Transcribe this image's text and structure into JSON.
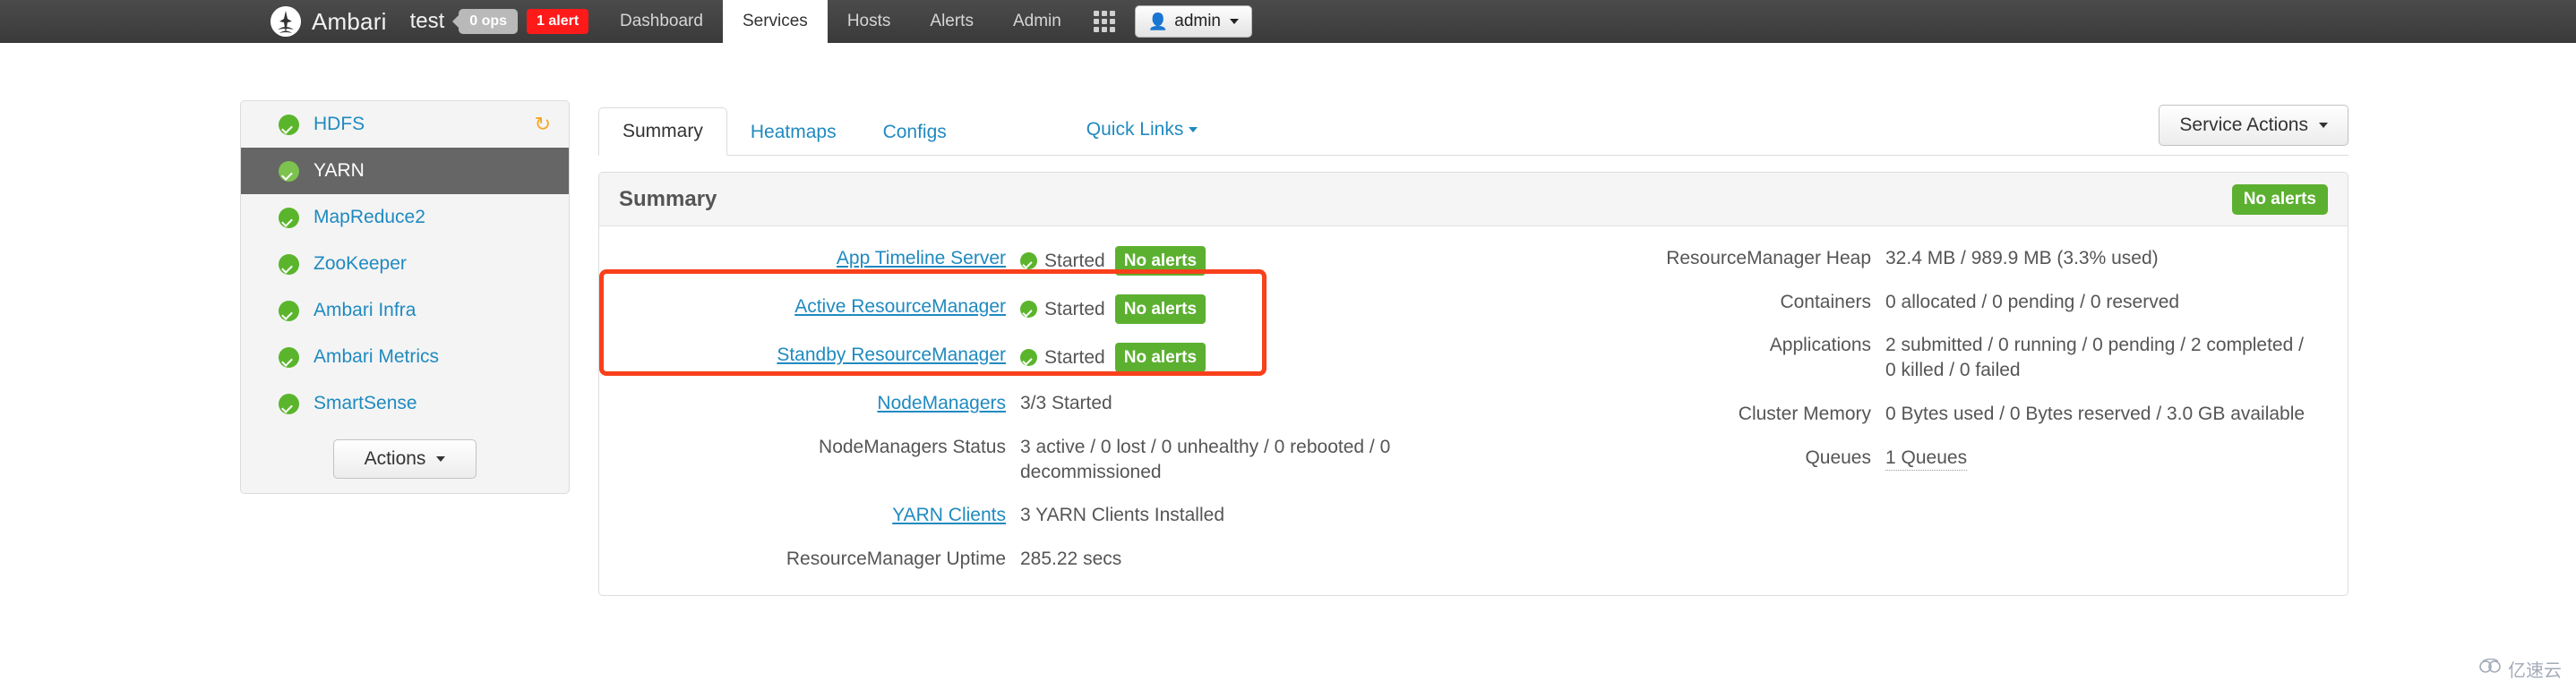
{
  "topnav": {
    "brand": "Ambari",
    "cluster": "test",
    "ops_badge": "0 ops",
    "alert_badge": "1 alert",
    "logo_icon": "ambari-logo-icon",
    "grid_icon": "app-grid-icon",
    "user_icon": "person-icon",
    "user_label": "admin",
    "items": [
      {
        "label": "Dashboard",
        "active": false
      },
      {
        "label": "Services",
        "active": true
      },
      {
        "label": "Hosts",
        "active": false
      },
      {
        "label": "Alerts",
        "active": false
      },
      {
        "label": "Admin",
        "active": false
      }
    ]
  },
  "sidebar": {
    "services": [
      {
        "label": "HDFS",
        "selected": false,
        "restart_icon": "restart-required-icon",
        "status_icon": "status-ok-icon"
      },
      {
        "label": "YARN",
        "selected": true,
        "restart_icon": "",
        "status_icon": "status-ok-icon"
      },
      {
        "label": "MapReduce2",
        "selected": false,
        "restart_icon": "",
        "status_icon": "status-ok-icon"
      },
      {
        "label": "ZooKeeper",
        "selected": false,
        "restart_icon": "",
        "status_icon": "status-ok-icon"
      },
      {
        "label": "Ambari Infra",
        "selected": false,
        "restart_icon": "",
        "status_icon": "status-ok-icon"
      },
      {
        "label": "Ambari Metrics",
        "selected": false,
        "restart_icon": "",
        "status_icon": "status-ok-icon"
      },
      {
        "label": "SmartSense",
        "selected": false,
        "restart_icon": "",
        "status_icon": "status-ok-icon"
      }
    ],
    "actions_label": "Actions"
  },
  "tabs": [
    {
      "label": "Summary",
      "active": true
    },
    {
      "label": "Heatmaps",
      "active": false
    },
    {
      "label": "Configs",
      "active": false
    }
  ],
  "quick_links_label": "Quick Links",
  "service_actions_label": "Service Actions",
  "panel": {
    "title": "Summary",
    "badge": "No alerts",
    "left_rows": [
      {
        "label": "App Timeline Server",
        "label_is_link": true,
        "kind": "status",
        "status_text": "Started",
        "alert_badge": "No alerts"
      },
      {
        "label": "Active ResourceManager",
        "label_is_link": true,
        "kind": "status",
        "status_text": "Started",
        "alert_badge": "No alerts"
      },
      {
        "label": "Standby ResourceManager",
        "label_is_link": true,
        "kind": "status",
        "status_text": "Started",
        "alert_badge": "No alerts"
      },
      {
        "label": "NodeManagers",
        "label_is_link": true,
        "kind": "text",
        "value": "3/3 Started"
      },
      {
        "label": "NodeManagers Status",
        "label_is_link": false,
        "kind": "text",
        "value": "3 active / 0 lost / 0 unhealthy / 0 rebooted / 0 decommissioned"
      },
      {
        "label": "YARN Clients",
        "label_is_link": true,
        "kind": "text",
        "value": "3 YARN Clients Installed"
      },
      {
        "label": "ResourceManager Uptime",
        "label_is_link": false,
        "kind": "text",
        "value": "285.22 secs"
      }
    ],
    "right_rows": [
      {
        "label": "ResourceManager Heap",
        "value": "32.4 MB / 989.9 MB (3.3% used)",
        "dotted": false
      },
      {
        "label": "Containers",
        "value": "0 allocated / 0 pending / 0 reserved",
        "dotted": false
      },
      {
        "label": "Applications",
        "value": "2 submitted / 0 running / 0 pending / 2 completed / 0 killed / 0 failed",
        "dotted": false
      },
      {
        "label": "Cluster Memory",
        "value": "0 Bytes used / 0 Bytes reserved / 3.0 GB available",
        "dotted": false
      },
      {
        "label": "Queues",
        "value": "1 Queues",
        "dotted": true
      }
    ]
  },
  "annotation": {
    "color": "#f8401a",
    "shape": "rounded-rectangle"
  },
  "watermark": {
    "text": "亿速云",
    "icon": "cloud-icon"
  }
}
